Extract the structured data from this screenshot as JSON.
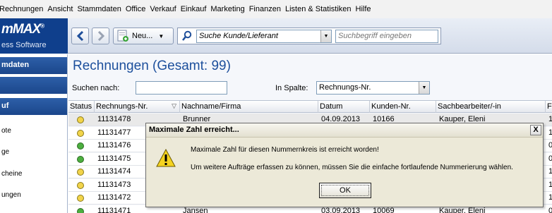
{
  "menu": [
    "Rechnungen",
    "Ansicht",
    "Stammdaten",
    "Office",
    "Verkauf",
    "Einkauf",
    "Marketing",
    "Finanzen",
    "Listen & Statistiken",
    "Hilfe"
  ],
  "logo": {
    "line1": "mMAX",
    "registered": "®",
    "line2": "ess Software"
  },
  "toolbar": {
    "new_label": "Neu...",
    "search_mode": "Suche Kunde/Lieferant",
    "search_placeholder": "Suchbegriff eingeben"
  },
  "sidebar": {
    "headers": [
      "mdaten",
      "",
      "uf"
    ],
    "items": [
      "ote",
      "ge",
      "cheine",
      "ungen"
    ]
  },
  "main": {
    "title": "Rechnungen (Gesamt: 99)",
    "search_label": "Suchen nach:",
    "search_value": "",
    "column_label": "In Spalte:",
    "column_value": "Rechnungs-Nr."
  },
  "grid": {
    "columns": [
      "Status",
      "Rechnungs-Nr.",
      "Nachname/Firma",
      "Datum",
      "Kunden-Nr.",
      "Sachbearbeiter/-in",
      "F"
    ],
    "rows": [
      {
        "status": "yellow",
        "nr": "11131478",
        "name": "Brunner",
        "datum": "04.09.2013",
        "kunde": "10166",
        "sb": "Kauper, Eleni",
        "f": "1"
      },
      {
        "status": "yellow",
        "nr": "11131477",
        "name": "",
        "datum": "",
        "kunde": "",
        "sb": "",
        "f": "1"
      },
      {
        "status": "green",
        "nr": "11131476",
        "name": "",
        "datum": "",
        "kunde": "",
        "sb": "",
        "f": "0"
      },
      {
        "status": "green",
        "nr": "11131475",
        "name": "",
        "datum": "",
        "kunde": "",
        "sb": "",
        "f": "0"
      },
      {
        "status": "yellow",
        "nr": "11131474",
        "name": "",
        "datum": "",
        "kunde": "",
        "sb": "",
        "f": "1"
      },
      {
        "status": "yellow",
        "nr": "11131473",
        "name": "",
        "datum": "",
        "kunde": "",
        "sb": "",
        "f": "1"
      },
      {
        "status": "yellow",
        "nr": "11131472",
        "name": "",
        "datum": "",
        "kunde": "",
        "sb": "",
        "f": "1"
      },
      {
        "status": "green",
        "nr": "11131471",
        "name": "Jansen",
        "datum": "03.09.2013",
        "kunde": "10069",
        "sb": "Kauper, Eleni",
        "f": "0"
      }
    ]
  },
  "dialog": {
    "title": "Maximale Zahl erreicht...",
    "close": "X",
    "message1": "Maximale Zahl für diesen Nummernkreis ist erreicht worden!",
    "message2": "Um weitere Aufträge erfassen zu können, müssen Sie die einfache fortlaufende Nummerierung wählen.",
    "ok": "OK"
  },
  "colors": {
    "brand": "#0f3f8c",
    "title": "#1c4f9c",
    "dot_yellow": "#f2d44a",
    "dot_green": "#4caf3f"
  }
}
